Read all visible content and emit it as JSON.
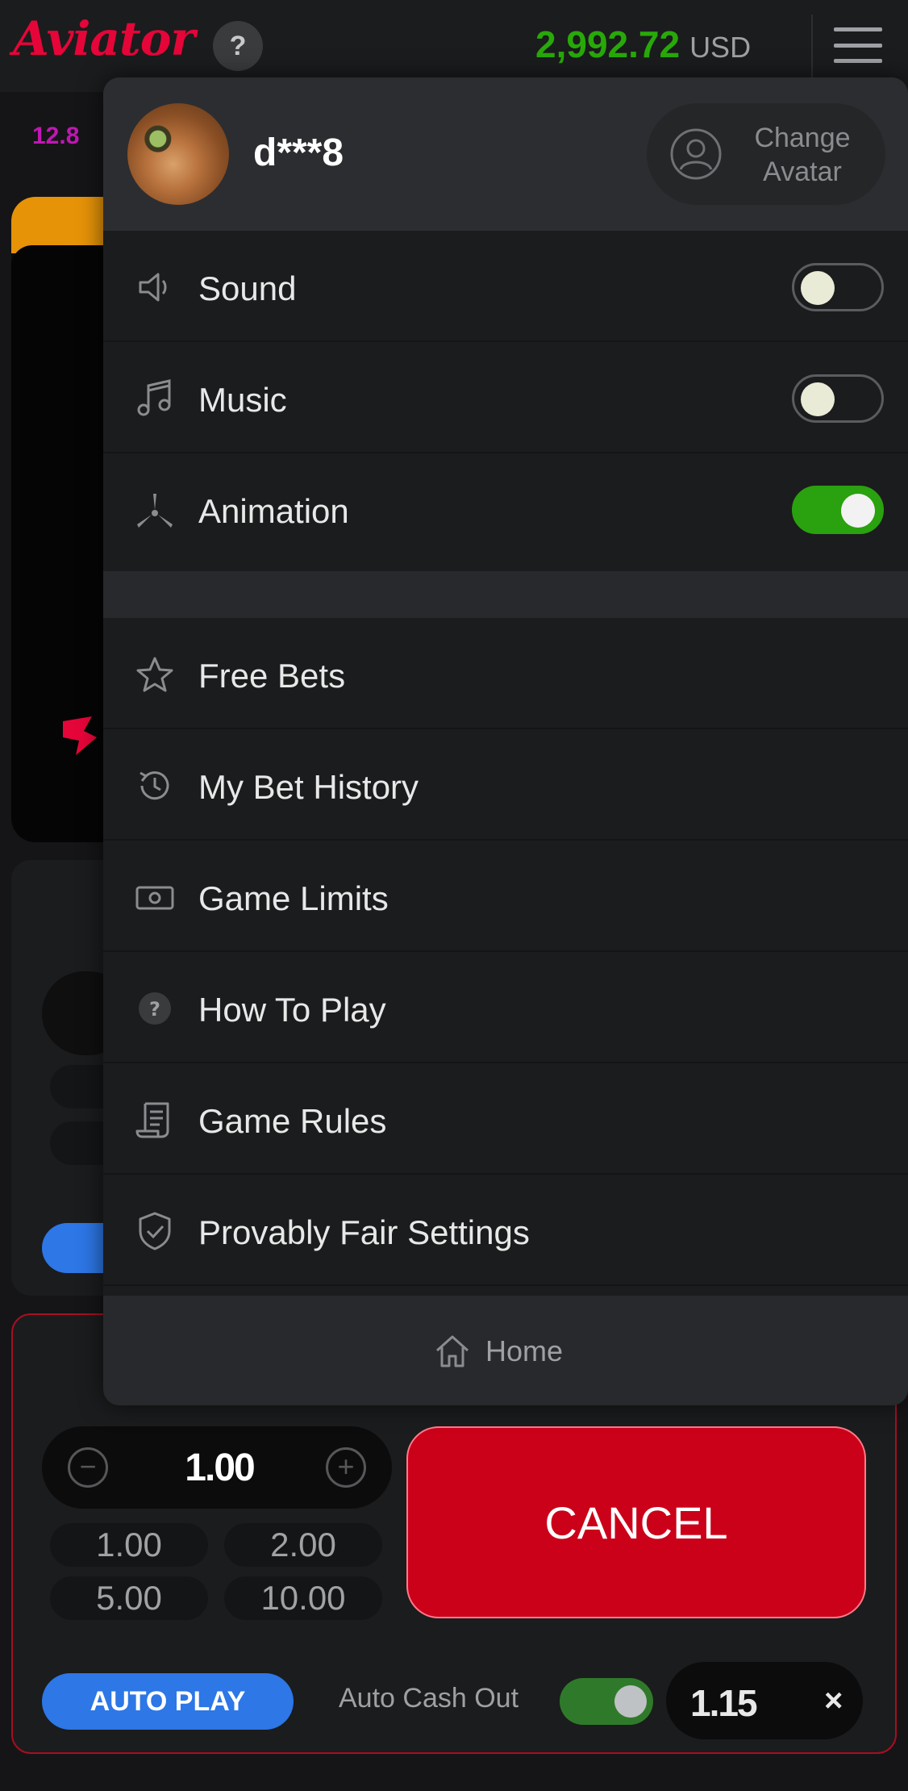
{
  "header": {
    "logo": "Aviator",
    "help_label": "?",
    "balance": "2,992.72",
    "currency": "USD"
  },
  "background": {
    "multiplier_chip": "12.8",
    "stake_value": "1.00",
    "quick_amounts": [
      "1.00",
      "2.00",
      "5.00",
      "10.00"
    ],
    "cancel_label": "CANCEL",
    "auto_play_label": "AUTO PLAY",
    "auto_cash_out_label": "Auto Cash Out",
    "auto_cash_out_value": "1.15",
    "auto_cash_out_clear": "×"
  },
  "menu": {
    "username": "d***8",
    "change_avatar_line1": "Change",
    "change_avatar_line2": "Avatar",
    "settings": [
      {
        "label": "Sound",
        "icon": "speaker-icon",
        "enabled": false
      },
      {
        "label": "Music",
        "icon": "music-note-icon",
        "enabled": false
      },
      {
        "label": "Animation",
        "icon": "propeller-icon",
        "enabled": true
      }
    ],
    "links": [
      {
        "label": "Free Bets",
        "icon": "star-icon"
      },
      {
        "label": "My Bet History",
        "icon": "history-icon"
      },
      {
        "label": "Game Limits",
        "icon": "banknote-icon"
      },
      {
        "label": "How To Play",
        "icon": "question-icon"
      },
      {
        "label": "Game Rules",
        "icon": "scroll-icon"
      },
      {
        "label": "Provably Fair Settings",
        "icon": "shield-check-icon"
      }
    ],
    "home_label": "Home"
  },
  "colors": {
    "brand_red": "#e50539",
    "balance_green": "#28a909",
    "toggle_on": "#2aa10f",
    "auto_play_blue": "#2d77e6",
    "cancel_red": "#cb011a"
  }
}
